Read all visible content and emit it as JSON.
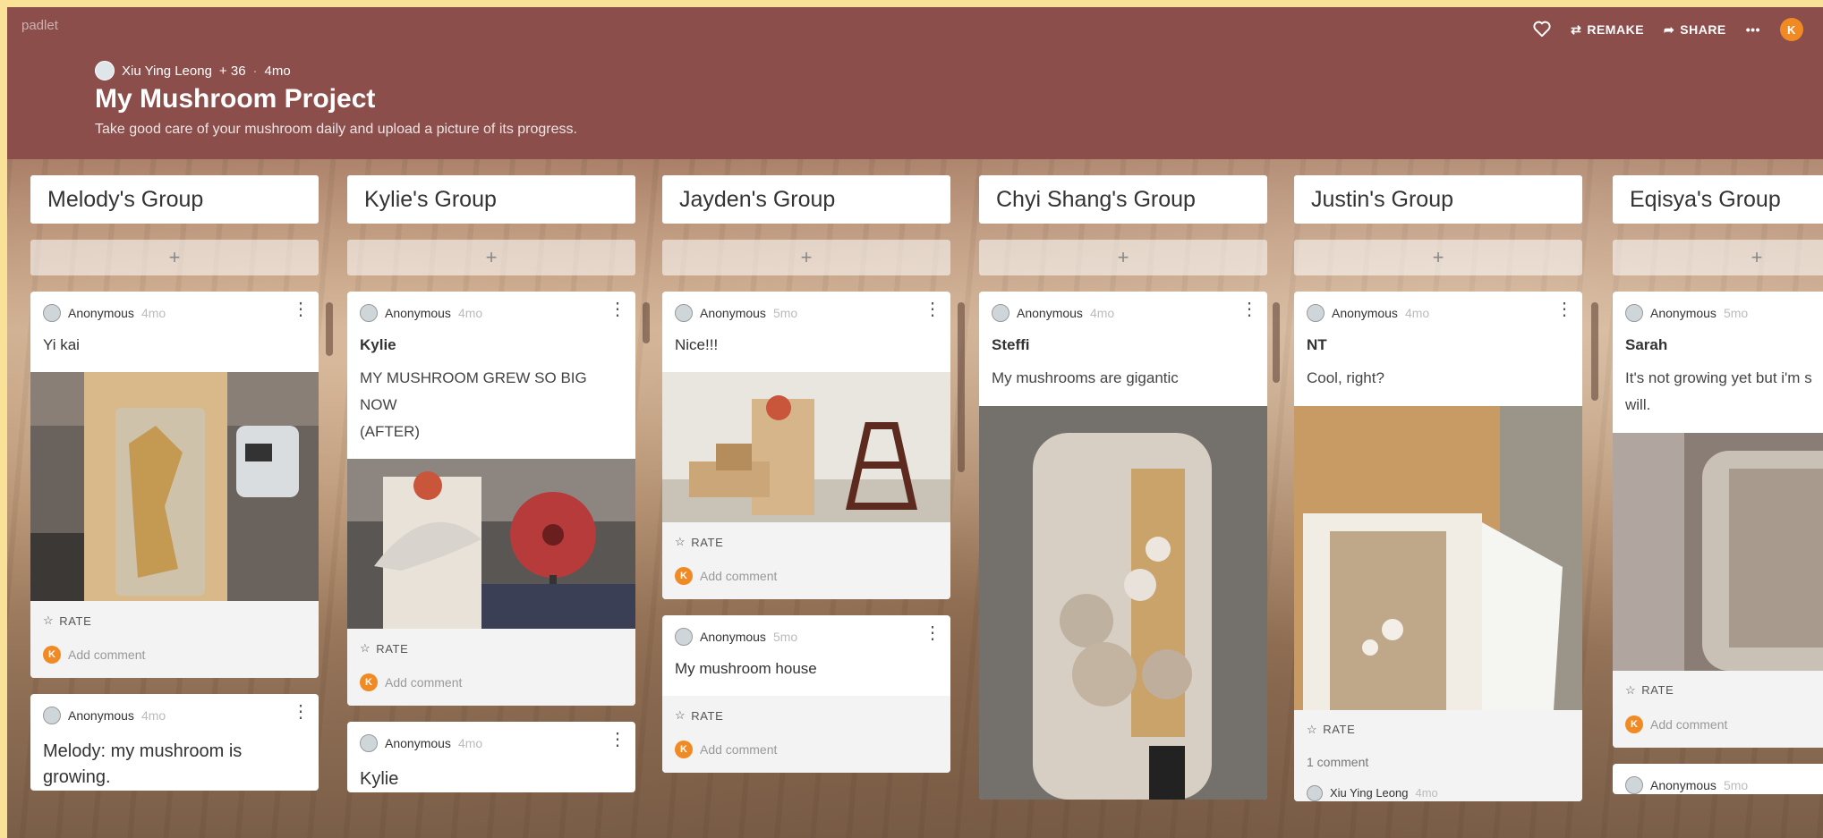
{
  "app": {
    "logo": "padlet"
  },
  "toolbar": {
    "remake": "REMAKE",
    "share": "SHARE",
    "more": "•••",
    "user_initial": "K"
  },
  "board": {
    "author": "Xiu Ying Leong",
    "plus": "+ 36",
    "dot": "·",
    "age": "4mo",
    "title": "My Mushroom Project",
    "description": "Take good care of your mushroom daily and upload a picture of its progress."
  },
  "labels": {
    "rate": "RATE",
    "add_comment": "Add comment",
    "add": "+",
    "menu": "⋮",
    "user_initial": "K"
  },
  "columns": [
    {
      "title": "Melody's Group",
      "posts": [
        {
          "author": "Anonymous",
          "time": "4mo",
          "title": "Yi kai",
          "has_image": true
        },
        {
          "author": "Anonymous",
          "time": "4mo",
          "title": "Melody: my mushroom is growing."
        }
      ]
    },
    {
      "title": "Kylie's Group",
      "posts": [
        {
          "author": "Anonymous",
          "time": "4mo",
          "title": "Kylie",
          "body_lines": [
            "MY  MUSHROOM GREW SO BIG",
            "NOW",
            "(AFTER)"
          ],
          "has_image": true
        },
        {
          "author": "Anonymous",
          "time": "4mo",
          "title": "Kylie"
        }
      ]
    },
    {
      "title": "Jayden's Group",
      "posts": [
        {
          "author": "Anonymous",
          "time": "5mo",
          "title": "Nice!!!",
          "has_image": true
        },
        {
          "author": "Anonymous",
          "time": "5mo",
          "title": "My mushroom house"
        }
      ]
    },
    {
      "title": "Chyi Shang's Group",
      "posts": [
        {
          "author": "Anonymous",
          "time": "4mo",
          "title": "Steffi",
          "body": "My mushrooms are gigantic",
          "has_image": true
        }
      ]
    },
    {
      "title": "Justin's Group",
      "posts": [
        {
          "author": "Anonymous",
          "time": "4mo",
          "title": "NT",
          "body": "Cool, right?",
          "has_image": true,
          "comments_count": "1 comment",
          "commenter": "Xiu Ying Leong",
          "commenter_time": "4mo"
        }
      ]
    },
    {
      "title": "Eqisya's Group",
      "posts": [
        {
          "author": "Anonymous",
          "time": "5mo",
          "title": "Sarah",
          "body_lines": [
            "It's not growing yet but i'm s",
            "will."
          ],
          "has_image": true
        },
        {
          "author": "Anonymous",
          "time": "5mo"
        }
      ]
    }
  ],
  "colors": {
    "header": "#8b4e4b",
    "accent": "#f08a24",
    "frame": "#f9e197"
  }
}
